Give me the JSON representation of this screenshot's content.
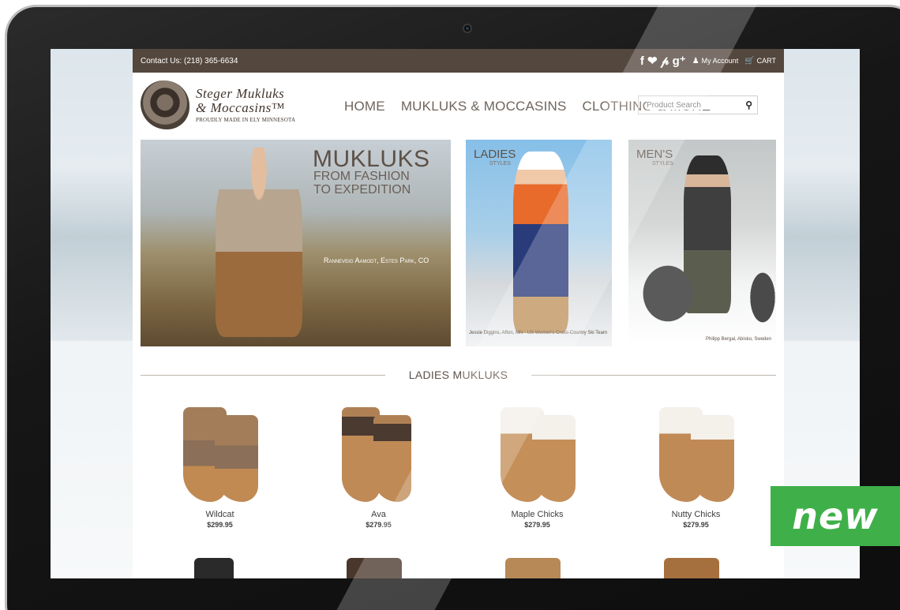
{
  "topbar": {
    "contact": "Contact Us: (218) 365-6634",
    "social": "f ❤ 𝓅 g⁺",
    "my_account": "My Account",
    "cart": "CART"
  },
  "logo": {
    "line1": "Steger Mukluks",
    "line2": "& Moccasins™",
    "line3": "PROUDLY MADE IN ELY MINNESOTA"
  },
  "nav": {
    "items": [
      "HOME",
      "MUKLUKS & MOCCASINS",
      "CLOTHING & MORE"
    ]
  },
  "search": {
    "placeholder": "Product Search"
  },
  "banners": {
    "main": {
      "title": "MUKLUKS",
      "sub1": "FROM FASHION",
      "sub2": "TO EXPEDITION",
      "credit": "Ranneveig Aamodt, Estes Park, CO"
    },
    "ladies": {
      "title": "LADIES",
      "tag": "STYLES",
      "credit": "Jessie Diggins, Afton, MN · US Women's Cross-Country Ski Team"
    },
    "mens": {
      "title": "MEN'S",
      "tag": "STYLES",
      "credit": "Philipp Bergal, Abisko, Sweden"
    }
  },
  "section": {
    "title": "LADIES MUKLUKS"
  },
  "products": [
    {
      "name": "Wildcat",
      "price": "$299.95"
    },
    {
      "name": "Ava",
      "price": "$279.95"
    },
    {
      "name": "Maple Chicks",
      "price": "$279.95"
    },
    {
      "name": "Nutty Chicks",
      "price": "$279.95"
    }
  ],
  "badge": {
    "label": "new"
  },
  "colors": {
    "topbar": "#54473d",
    "badge": "#3fb049"
  }
}
